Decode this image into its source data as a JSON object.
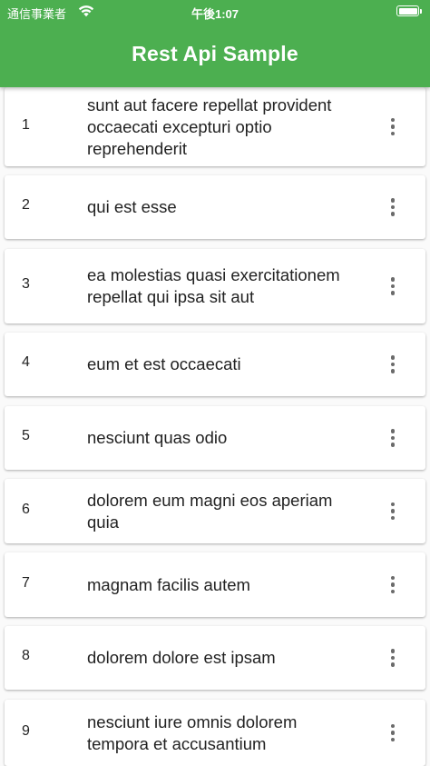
{
  "status_bar": {
    "carrier": "通信事業者",
    "time": "午後1:07",
    "wifi_icon": "wifi-icon",
    "battery_icon": "battery-icon"
  },
  "app_bar": {
    "title": "Rest Api Sample"
  },
  "posts": [
    {
      "id": "1",
      "title": "sunt aut facere repellat provident occaecati excepturi optio reprehenderit",
      "menu_icon": "more-vert-icon"
    },
    {
      "id": "2",
      "title": "qui est esse",
      "menu_icon": "more-vert-icon"
    },
    {
      "id": "3",
      "title": "ea molestias quasi exercitationem repellat qui ipsa sit aut",
      "menu_icon": "more-vert-icon"
    },
    {
      "id": "4",
      "title": "eum et est occaecati",
      "menu_icon": "more-vert-icon"
    },
    {
      "id": "5",
      "title": "nesciunt quas odio",
      "menu_icon": "more-vert-icon"
    },
    {
      "id": "6",
      "title": "dolorem eum magni eos aperiam quia",
      "menu_icon": "more-vert-icon"
    },
    {
      "id": "7",
      "title": "magnam facilis autem",
      "menu_icon": "more-vert-icon"
    },
    {
      "id": "8",
      "title": "dolorem dolore est ipsam",
      "menu_icon": "more-vert-icon"
    },
    {
      "id": "9",
      "title": "nesciunt iure omnis dolorem tempora et accusantium",
      "menu_icon": "more-vert-icon"
    }
  ],
  "colors": {
    "app_bar": "#4caf50",
    "card": "#ffffff",
    "text": "#222222",
    "icon": "#6b6b6b"
  }
}
